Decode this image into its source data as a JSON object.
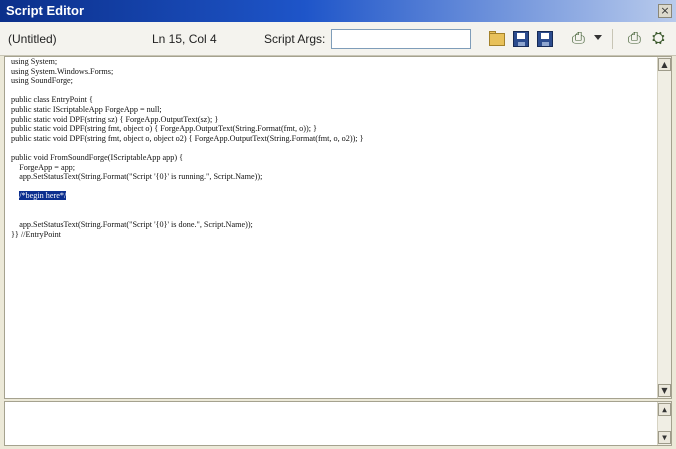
{
  "window": {
    "title": "Script Editor",
    "close_glyph": "×"
  },
  "toolbar": {
    "file_name": "(Untitled)",
    "cursor_position": "Ln 15, Col 4",
    "script_args_label": "Script Args:",
    "script_args_value": "",
    "icons": [
      "open-folder-icon",
      "save-icon",
      "save-all-icon",
      "compile-run-icon",
      "dropdown-arrow-icon",
      "run-icon",
      "stop-icon"
    ]
  },
  "editor": {
    "lines": [
      "using System;",
      "using System.Windows.Forms;",
      "using SoundForge;",
      "",
      "public class EntryPoint {",
      "public static IScriptableApp ForgeApp = null;",
      "public static void DPF(string sz) { ForgeApp.OutputText(sz); }",
      "public static void DPF(string fmt, object o) { ForgeApp.OutputText(String.Format(fmt, o)); }",
      "public static void DPF(string fmt, object o, object o2) { ForgeApp.OutputText(String.Format(fmt, o, o2)); }",
      "",
      "public void FromSoundForge(IScriptableApp app) {",
      "    ForgeApp = app;",
      "    app.SetStatusText(String.Format(\"Script '{0}' is running.\", Script.Name));",
      "",
      "    /*begin here*/",
      "",
      "",
      "    app.SetStatusText(String.Format(\"Script '{0}' is done.\", Script.Name));",
      "}} //EntryPoint"
    ],
    "highlighted_line_index": 14
  },
  "output": {
    "text": ""
  },
  "scrollbar": {
    "up_glyph": "▲",
    "down_glyph": "▼"
  }
}
